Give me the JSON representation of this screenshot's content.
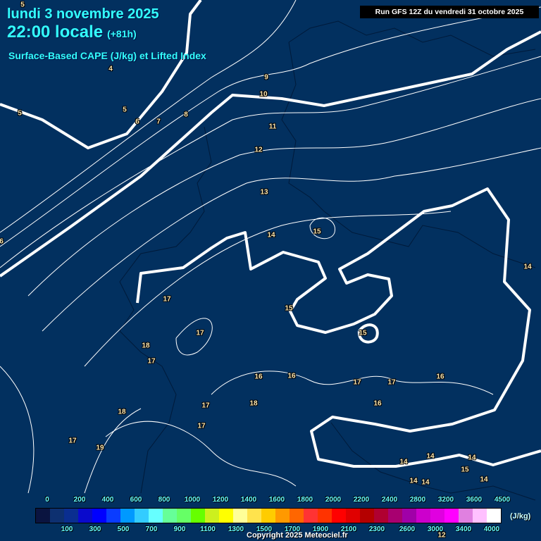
{
  "header": {
    "date": "lundi 3 novembre 2025",
    "time": "22:00 locale",
    "offset": "(+81h)",
    "title": "Surface-Based CAPE (J/kg) et Lifted Index",
    "run": "Run GFS 12Z du vendredi 31 octobre 2025"
  },
  "contour_labels": [
    "5",
    "4",
    "5",
    "5",
    "6",
    "7",
    "8",
    "9",
    "10",
    "11",
    "12",
    "13",
    "14",
    "15",
    "6",
    "14",
    "17",
    "15",
    "17",
    "18",
    "17",
    "15",
    "16",
    "16",
    "17",
    "17",
    "16",
    "16",
    "18",
    "17",
    "17",
    "18",
    "19",
    "17",
    "14",
    "14",
    "14",
    "15",
    "14",
    "14",
    "14",
    "12"
  ],
  "legend": {
    "unit": "(J/kg)",
    "top_ticks": [
      "0",
      "200",
      "400",
      "600",
      "800",
      "1000",
      "1200",
      "1400",
      "1600",
      "1800",
      "2000",
      "2200",
      "2400",
      "2800",
      "3200",
      "3600",
      "4500"
    ],
    "bottom_ticks": [
      "100",
      "300",
      "500",
      "700",
      "900",
      "1100",
      "1300",
      "1500",
      "1700",
      "1900",
      "2100",
      "2300",
      "2600",
      "3000",
      "3400",
      "4000"
    ],
    "colors": [
      "#0a1440",
      "#0d3070",
      "#0a2e90",
      "#0a0acc",
      "#0000ff",
      "#0a3cff",
      "#0099ff",
      "#33ccff",
      "#66ffff",
      "#66ff99",
      "#66ff66",
      "#66ff00",
      "#ccf01e",
      "#ffff00",
      "#ffff99",
      "#ffe34d",
      "#ffcc00",
      "#ff9900",
      "#ff6600",
      "#ff3333",
      "#ff3300",
      "#ff0000",
      "#e00000",
      "#b40000",
      "#b00030",
      "#a80070",
      "#a000a8",
      "#cc00cc",
      "#e000e0",
      "#ff00ff",
      "#e080e0",
      "#ffc0ff",
      "#ffffff"
    ]
  },
  "copyright": "Copyright 2025 Meteociel.fr"
}
